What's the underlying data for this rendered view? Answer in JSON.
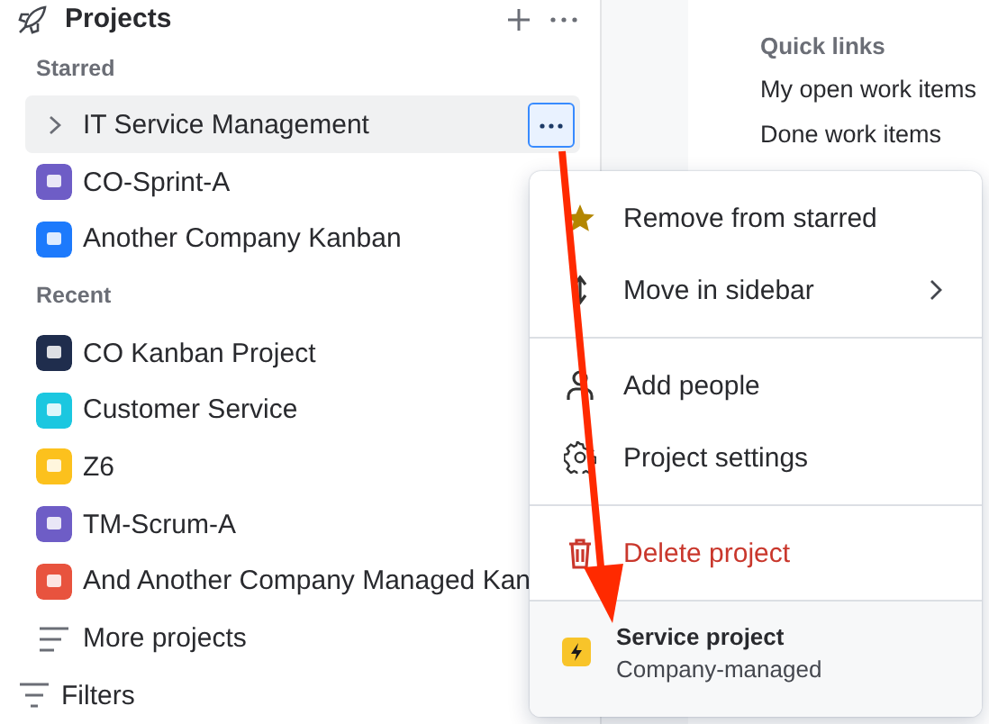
{
  "sidebar": {
    "title": "Projects",
    "sections": [
      {
        "label": "Starred",
        "items": [
          {
            "name": "IT Service Management",
            "kind": "expandable",
            "selected": true
          },
          {
            "name": "CO-Sprint-A",
            "kind": "project",
            "color": "#6e5dc6",
            "selected": false
          },
          {
            "name": "Another Company Kanban",
            "kind": "project",
            "color": "#1d7afc",
            "selected": false
          }
        ]
      },
      {
        "label": "Recent",
        "items": [
          {
            "name": "CO Kanban Project",
            "kind": "project",
            "color": "#1f2d4d",
            "selected": false
          },
          {
            "name": "Customer Service",
            "kind": "project",
            "color": "#1bc7e0",
            "selected": false
          },
          {
            "name": "Z6",
            "kind": "project",
            "color": "#fcc11d",
            "selected": false
          },
          {
            "name": "TM-Scrum-A",
            "kind": "project",
            "color": "#6e5dc6",
            "selected": false
          },
          {
            "name": "And Another Company Managed Kan",
            "kind": "project",
            "color": "#e8533e",
            "selected": false
          }
        ]
      }
    ],
    "more": "More projects",
    "filters": "Filters"
  },
  "quick_links": {
    "title": "Quick links",
    "items": [
      "My open work items",
      "Done work items"
    ]
  },
  "menu": {
    "groups": [
      [
        {
          "label": "Remove from starred",
          "kind": "star",
          "danger": false
        },
        {
          "label": "Move in sidebar",
          "kind": "move",
          "danger": false
        }
      ],
      [
        {
          "label": "Add people",
          "kind": "people",
          "danger": false
        },
        {
          "label": "Project settings",
          "kind": "settings",
          "danger": false
        }
      ],
      [
        {
          "label": "Delete project",
          "kind": "delete",
          "danger": true
        }
      ]
    ],
    "footer": {
      "title": "Service project",
      "subtitle": "Company-managed"
    }
  }
}
